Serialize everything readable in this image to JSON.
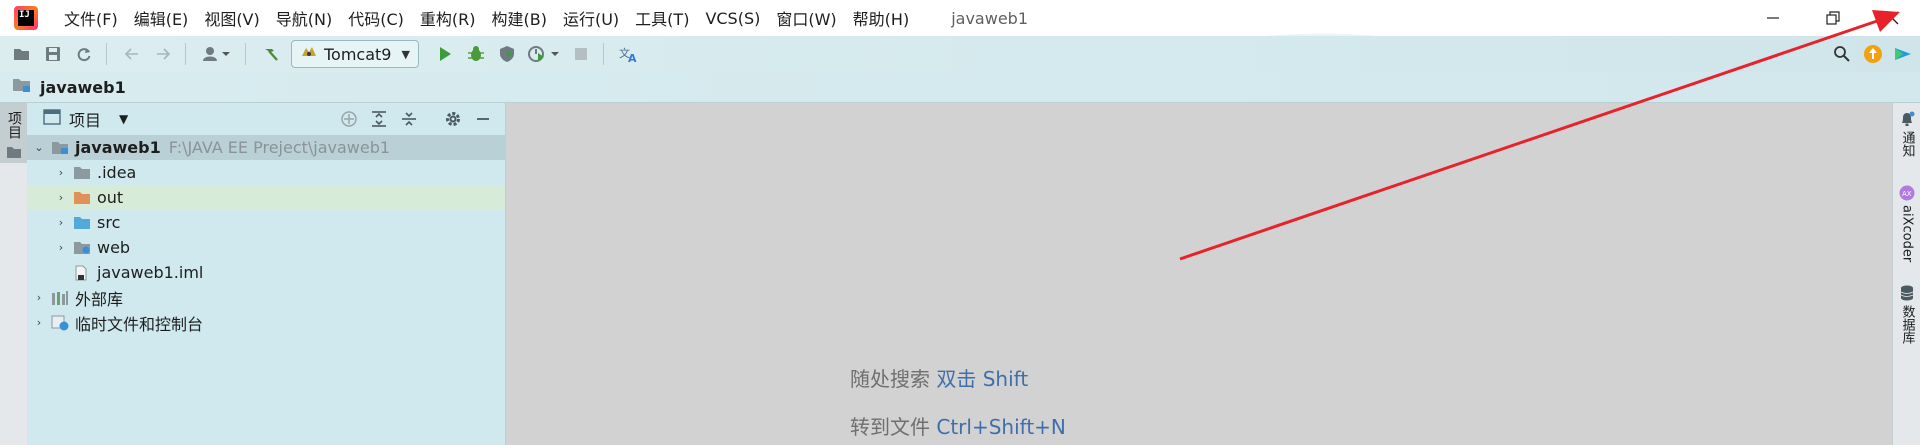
{
  "menubar": {
    "items": [
      "文件(F)",
      "编辑(E)",
      "视图(V)",
      "导航(N)",
      "代码(C)",
      "重构(R)",
      "构建(B)",
      "运行(U)",
      "工具(T)",
      "VCS(S)",
      "窗口(W)",
      "帮助(H)"
    ],
    "window_title": "javaweb1"
  },
  "toolbar": {
    "run_config": "Tomcat9"
  },
  "navbar": {
    "title": "javaweb1"
  },
  "left_stripe": {
    "project_label": "项目"
  },
  "project_panel": {
    "title": "项目",
    "tree": [
      {
        "label": "javaweb1",
        "path": "F:\\JAVA EE Preject\\javaweb1",
        "icon": "module-folder-icon"
      },
      {
        "label": ".idea",
        "icon": "folder-icon"
      },
      {
        "label": "out",
        "icon": "excluded-folder-icon"
      },
      {
        "label": "src",
        "icon": "source-folder-icon"
      },
      {
        "label": "web",
        "icon": "web-folder-icon"
      },
      {
        "label": "javaweb1.iml",
        "icon": "iml-file-icon"
      },
      {
        "label": "外部库",
        "icon": "library-icon"
      },
      {
        "label": "临时文件和控制台",
        "icon": "scratch-icon"
      }
    ]
  },
  "editor": {
    "hints": [
      {
        "text": "随处搜索",
        "key": "双击 Shift"
      },
      {
        "text": "转到文件",
        "key": "Ctrl+Shift+N"
      }
    ]
  },
  "right_stripe": {
    "notifications": "通知",
    "aixcoder": "aiXcoder",
    "database": "数据库"
  },
  "colors": {
    "menu_bg": "#ffffff",
    "toolbar_bg": "#d4eaee",
    "panel_bg": "#cfe9ef",
    "editor_bg": "#d2d2d2",
    "hint_key": "#3f6faa",
    "arrow": "#e8222a",
    "run_green": "#3c9b3c"
  }
}
